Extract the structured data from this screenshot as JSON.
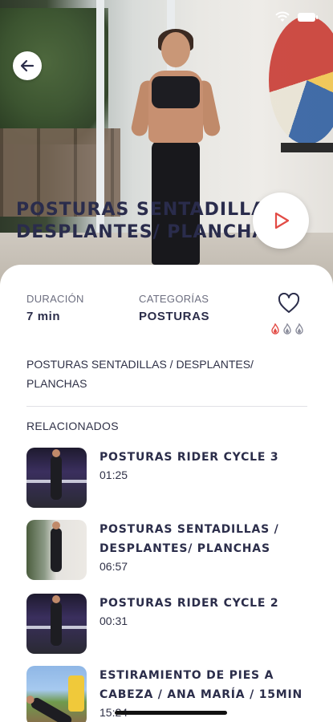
{
  "status_bar": {
    "wifi_icon": "wifi-icon",
    "battery_icon": "battery-icon"
  },
  "hero": {
    "title": "POSTURAS SENTADILLAS / DESPLANTES/ PLANCHAS",
    "title_line1": "POSTURAS SENTADILLAS /",
    "title_line2": "DESPLANTES/ PLANCHAS",
    "back_icon": "arrow-left-icon",
    "play_icon": "play-icon",
    "accent_color": "#e24b45"
  },
  "details": {
    "duration_label": "DURACIÓN",
    "duration_value": "7 min",
    "category_label": "CATEGORÍAS",
    "category_value": "POSTURAS",
    "favorite_icon": "heart-icon",
    "intensity": {
      "level": 1,
      "max": 3,
      "active_color": "#e24b45",
      "inactive_color": "#8b8d9c"
    },
    "description": "POSTURAS SENTADILLAS / DESPLANTES/ PLANCHAS"
  },
  "related": {
    "title": "RELACIONADOS",
    "items": [
      {
        "title": "POSTURAS RIDER CYCLE 3",
        "time": "01:25"
      },
      {
        "title": "POSTURAS SENTADILLAS / DESPLANTES/ PLANCHAS",
        "time": "06:57"
      },
      {
        "title": "POSTURAS RIDER CYCLE 2",
        "time": "00:31"
      },
      {
        "title": "ESTIRAMIENTO DE PIES A CABEZA / ANA MARÍA / 15MIN",
        "time": "15:24"
      }
    ]
  }
}
